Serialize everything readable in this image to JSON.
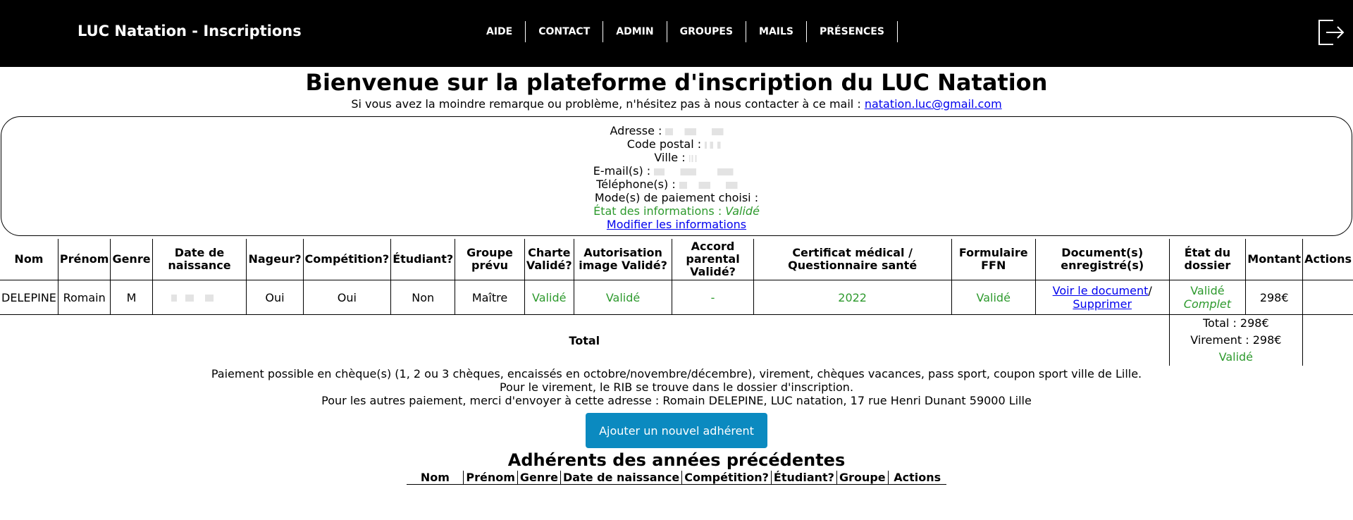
{
  "header": {
    "brand": "LUC Natation - Inscriptions",
    "nav": [
      "AIDE",
      "CONTACT",
      "ADMIN",
      "GROUPES",
      "MAILS",
      "PRÉSENCES"
    ],
    "logout_icon": "logout-icon"
  },
  "welcome": {
    "title": "Bienvenue sur la plateforme d'inscription du LUC Natation",
    "subtitle": "Si vous avez la moindre remarque ou problème, n'hésitez pas à nous contacter à ce mail :",
    "email": "natation.luc@gmail.com"
  },
  "info": {
    "adresse": "Adresse :",
    "code_postal": "Code postal :",
    "ville": "Ville :",
    "emails": "E-mail(s) :",
    "telephones": "Téléphone(s) :",
    "paiement": "Mode(s) de paiement choisi :",
    "etat_label": "État des informations :",
    "etat_value": "Validé",
    "modifier": "Modifier les informations"
  },
  "table": {
    "headers": [
      "Nom",
      "Prénom",
      "Genre",
      "Date de naissance",
      "Nageur?",
      "Compétition?",
      "Étudiant?",
      "Groupe prévu",
      "Charte Validé?",
      "Autorisation image Validé?",
      "Accord parental Validé?",
      "Certificat médical / Questionnaire santé",
      "Formulaire FFN",
      "Document(s) enregistré(s)",
      "État du dossier",
      "Montant",
      "Actions"
    ],
    "row": {
      "nom": "DELEPINE",
      "prenom": "Romain",
      "genre": "M",
      "naissance": "",
      "nageur": "Oui",
      "competition": "Oui",
      "etudiant": "Non",
      "groupe": "Maître",
      "charte": "Validé",
      "autorisation": "Validé",
      "accord": "-",
      "certificat": "2022",
      "ffn": "Validé",
      "doc_voir": "Voir le document",
      "doc_sep": "/",
      "doc_suppr": "Supprimer",
      "etat1": "Validé",
      "etat2": "Complet",
      "montant": "298€"
    },
    "total_label": "Total",
    "total_amount": "Total : 298€",
    "total_virement": "Virement : 298€",
    "total_status": "Validé"
  },
  "notes": [
    "Paiement possible en chèque(s) (1, 2 ou 3 chèques, encaissés en octobre/novembre/décembre), virement, chèques vacances, pass sport, coupon sport ville de Lille.",
    "Pour le virement, le RIB se trouve dans le dossier d'inscription.",
    "Pour les autres paiement, merci d'envoyer à cette adresse : Romain DELEPINE, LUC natation, 17 rue Henri Dunant 59000 Lille"
  ],
  "add_button": "Ajouter un nouvel adhérent",
  "previous": {
    "title": "Adhérents des années précédentes",
    "headers": [
      "Nom",
      "Prénom",
      "Genre",
      "Date de naissance",
      "Compétition?",
      "Étudiant?",
      "Groupe",
      "Actions"
    ]
  },
  "colors": {
    "green": "#2e9a2e",
    "button": "#0b8ac0",
    "link": "#0000ee"
  }
}
